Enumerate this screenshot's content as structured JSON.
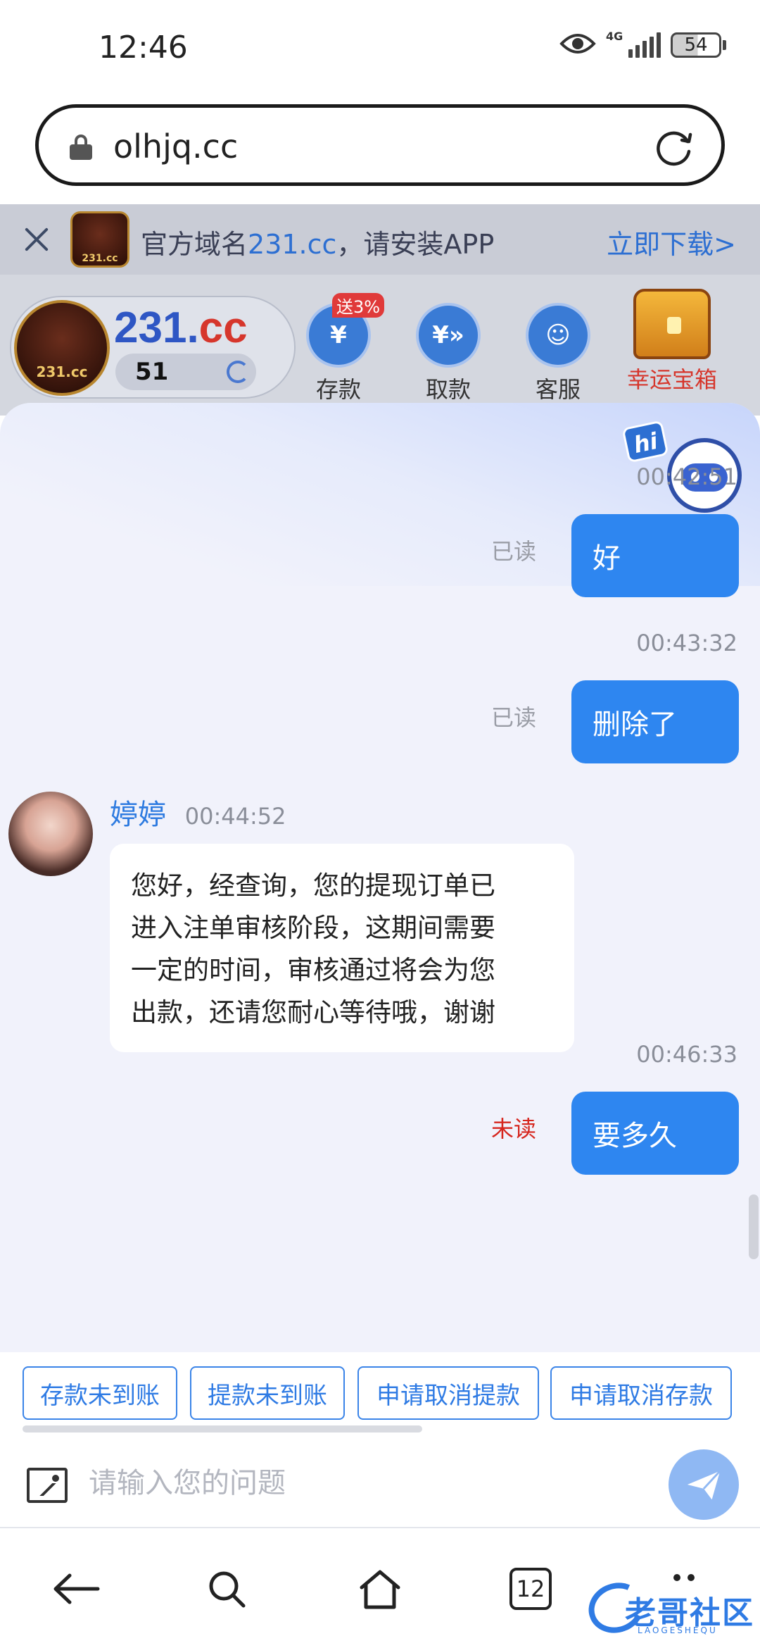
{
  "status_bar": {
    "time": "12:46",
    "network": "4G",
    "battery": "54"
  },
  "browser": {
    "url": "olhjq.cc"
  },
  "promo_banner": {
    "text_before": "官方域名",
    "domain": "231.cc",
    "text_after": "，请安装APP",
    "download": "立即下载>"
  },
  "brand": {
    "name_blue": "231.",
    "name_red": "cc",
    "balance": "51",
    "logo_text": "231.cc"
  },
  "quick_actions": [
    {
      "label": "存款",
      "badge": "送3%"
    },
    {
      "label": "取款"
    },
    {
      "label": "客服"
    },
    {
      "label": "幸运宝箱"
    }
  ],
  "chat": {
    "robot_badge": "hi",
    "messages": [
      {
        "time": "00:42:51",
        "text": "好",
        "status": "已读"
      },
      {
        "time": "00:43:32",
        "text": "删除了",
        "status": "已读"
      },
      {
        "agent": "婷婷",
        "time": "00:44:52",
        "lines": [
          "您好，经查询，您的提现订单已",
          "进入注单审核阶段，这期间需要",
          "一定的时间，审核通过将会为您",
          "出款，还请您耐心等待哦，谢谢"
        ]
      },
      {
        "time": "00:46:33",
        "text": "要多久",
        "status": "未读"
      }
    ]
  },
  "quick_questions": [
    "存款未到账",
    "提款未到账",
    "申请取消提款",
    "申请取消存款"
  ],
  "input": {
    "placeholder": "请输入您的问题"
  },
  "bottom_nav": {
    "tabs_count": "12"
  },
  "watermark": {
    "text": "老哥社区",
    "sub": "LAOGESHEQU"
  },
  "colors": {
    "accent": "#2e86f0",
    "unread": "#d6261e",
    "link": "#2d6fd2"
  }
}
